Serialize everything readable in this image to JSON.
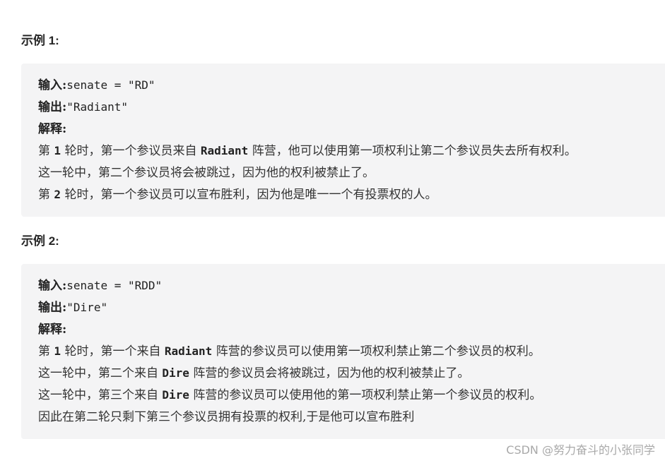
{
  "examples": [
    {
      "title": "示例 1:",
      "input_label": "输入:",
      "input_value": "senate = \"RD\"",
      "output_label": "输出:",
      "output_value": "\"Radiant\"",
      "explain_label": "解释:",
      "lines": [
        {
          "pre": "第 ",
          "code": "1",
          "mid": " 轮时，第一个参议员来自 ",
          "code2": "Radiant",
          "post": " 阵营，他可以使用第一项权利让第二个参议员失去所有权利。"
        },
        {
          "pre": "这一轮中，第二个参议员将会被跳过，因为他的权利被禁止了。"
        },
        {
          "pre": "第 ",
          "code": "2",
          "mid": " 轮时，第一个参议员可以宣布胜利，因为他是唯一一个有投票权的人。"
        }
      ]
    },
    {
      "title": "示例 2:",
      "input_label": "输入:",
      "input_value": "senate = \"RDD\"",
      "output_label": "输出:",
      "output_value": "\"Dire\"",
      "explain_label": "解释:",
      "lines": [
        {
          "pre": "第 ",
          "code": "1",
          "mid": " 轮时，第一个来自 ",
          "code2": "Radiant",
          "post": " 阵营的参议员可以使用第一项权利禁止第二个参议员的权利。"
        },
        {
          "pre": "这一轮中，第二个来自 ",
          "code2": "Dire",
          "post": " 阵营的参议员会将被跳过，因为他的权利被禁止了。"
        },
        {
          "pre": "这一轮中，第三个来自 ",
          "code2": "Dire",
          "post": " 阵营的参议员可以使用他的第一项权利禁止第一个参议员的权利。"
        },
        {
          "pre": "因此在第二轮只剩下第三个参议员拥有投票的权利,于是他可以宣布胜利"
        }
      ]
    }
  ],
  "watermark": "CSDN @努力奋斗的小张同学"
}
